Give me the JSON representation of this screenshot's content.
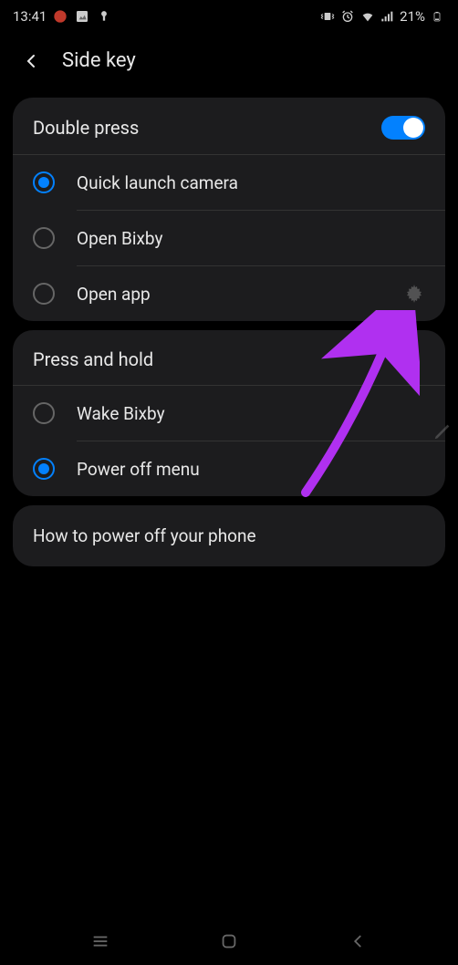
{
  "status_bar": {
    "time": "13:41",
    "battery_text": "21%"
  },
  "header": {
    "title": "Side key"
  },
  "double_press": {
    "title": "Double press",
    "toggle_on": true,
    "options": [
      {
        "label": "Quick launch camera",
        "selected": true
      },
      {
        "label": "Open Bixby",
        "selected": false
      },
      {
        "label": "Open app",
        "selected": false,
        "has_gear": true
      }
    ]
  },
  "press_hold": {
    "title": "Press and hold",
    "options": [
      {
        "label": "Wake Bixby",
        "selected": false
      },
      {
        "label": "Power off menu",
        "selected": true
      }
    ]
  },
  "info": {
    "text": "How to power off your phone"
  }
}
